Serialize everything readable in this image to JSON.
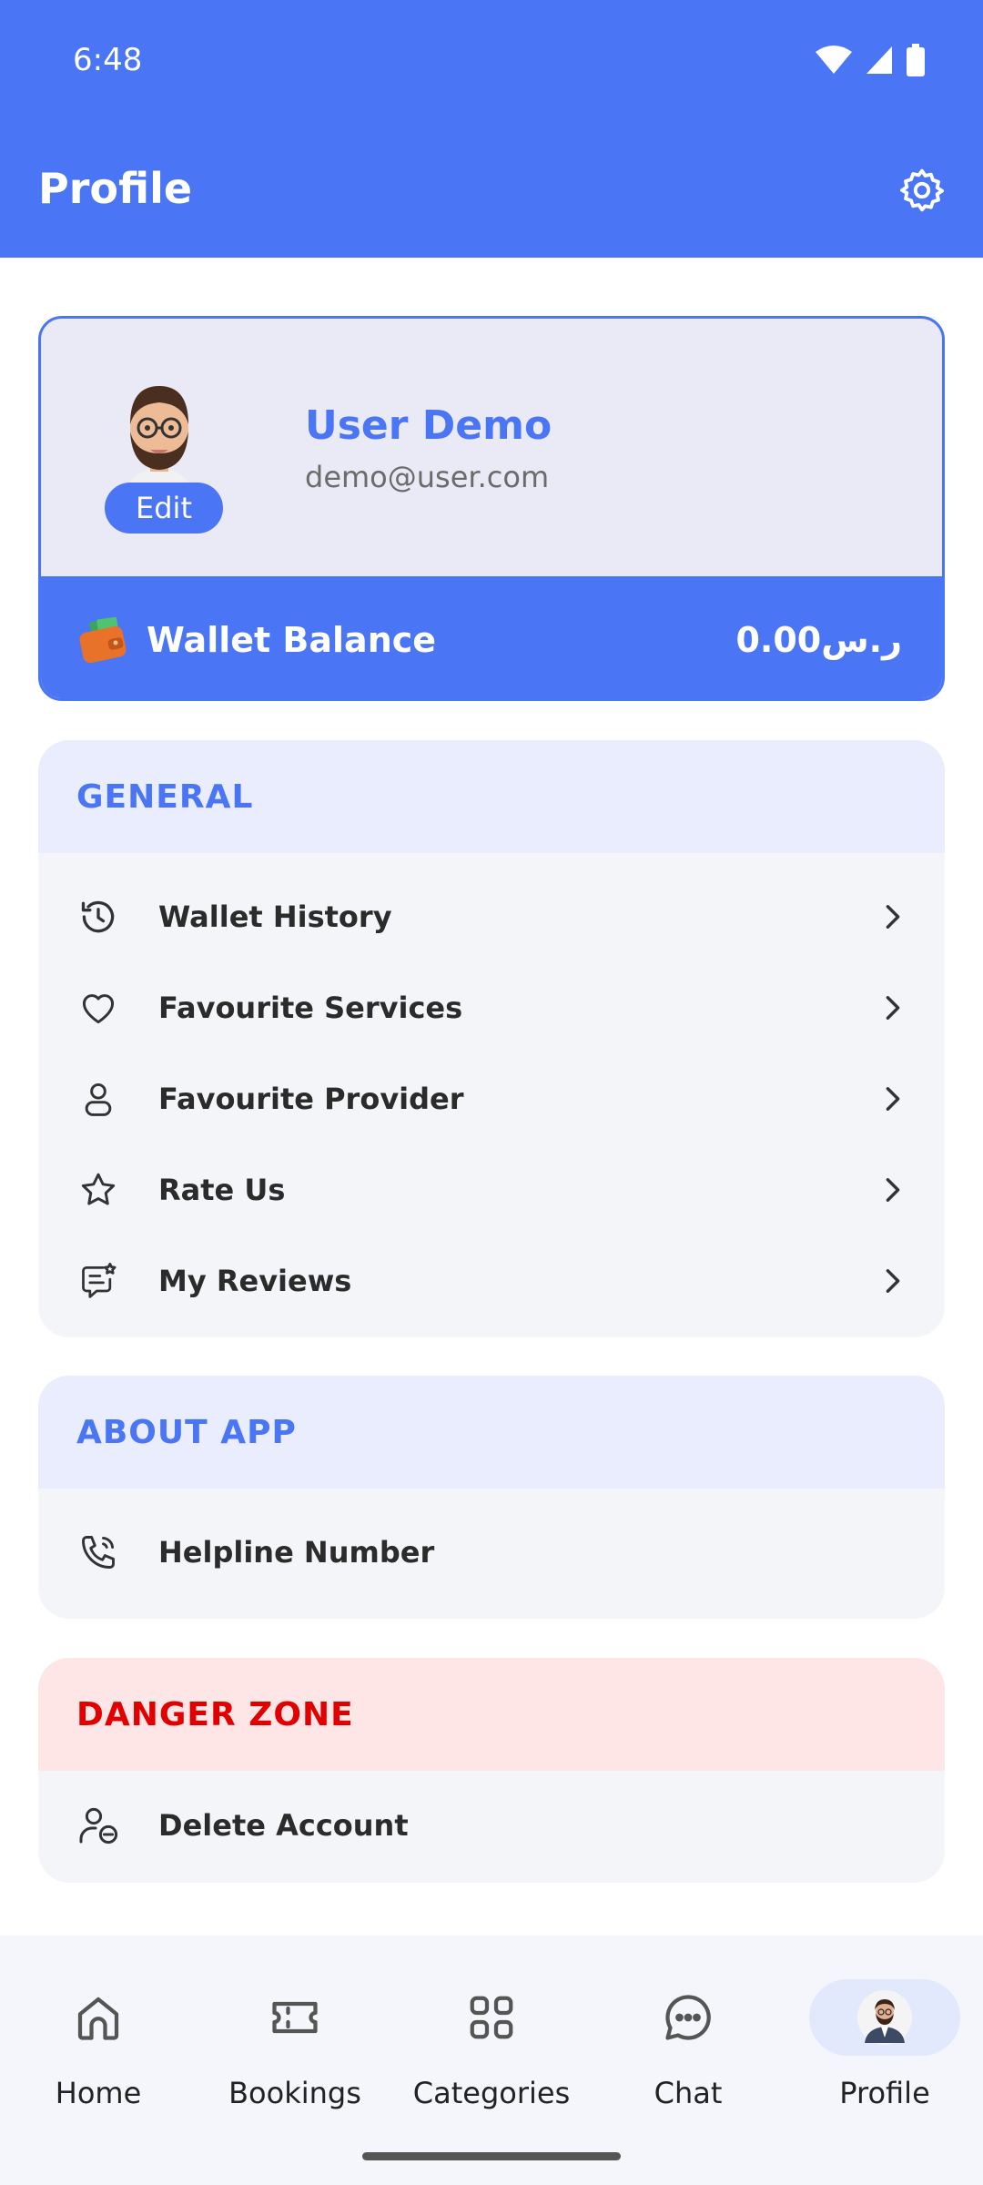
{
  "status_bar": {
    "time": "6:48"
  },
  "appbar": {
    "title": "Profile",
    "settings_icon": "gear-icon"
  },
  "profile": {
    "name": "User Demo",
    "email": "demo@user.com",
    "edit_label": "Edit",
    "wallet_label": "Wallet Balance",
    "wallet_amount": "0.00ر.س"
  },
  "sections": {
    "general": {
      "title": "GENERAL",
      "items": [
        {
          "label": "Wallet History",
          "icon": "history-icon"
        },
        {
          "label": "Favourite Services",
          "icon": "heart-icon"
        },
        {
          "label": "Favourite Provider",
          "icon": "person-icon"
        },
        {
          "label": "Rate Us",
          "icon": "star-icon"
        },
        {
          "label": "My Reviews",
          "icon": "reviews-icon"
        }
      ]
    },
    "about": {
      "title": "ABOUT APP",
      "items": [
        {
          "label": "Helpline Number",
          "icon": "phone-icon"
        }
      ]
    },
    "danger": {
      "title": "DANGER ZONE",
      "items": [
        {
          "label": "Delete Account",
          "icon": "remove-user-icon"
        }
      ]
    }
  },
  "bottom_nav": [
    {
      "label": "Home",
      "icon": "home-icon"
    },
    {
      "label": "Bookings",
      "icon": "ticket-icon"
    },
    {
      "label": "Categories",
      "icon": "grid-icon"
    },
    {
      "label": "Chat",
      "icon": "chat-icon"
    },
    {
      "label": "Profile",
      "icon": "avatar-icon",
      "active": true
    }
  ],
  "colors": {
    "primary": "#4a76f5",
    "danger": "#e00000",
    "danger_bg": "#ffe6e6",
    "section_head_bg": "#e9edfd"
  }
}
